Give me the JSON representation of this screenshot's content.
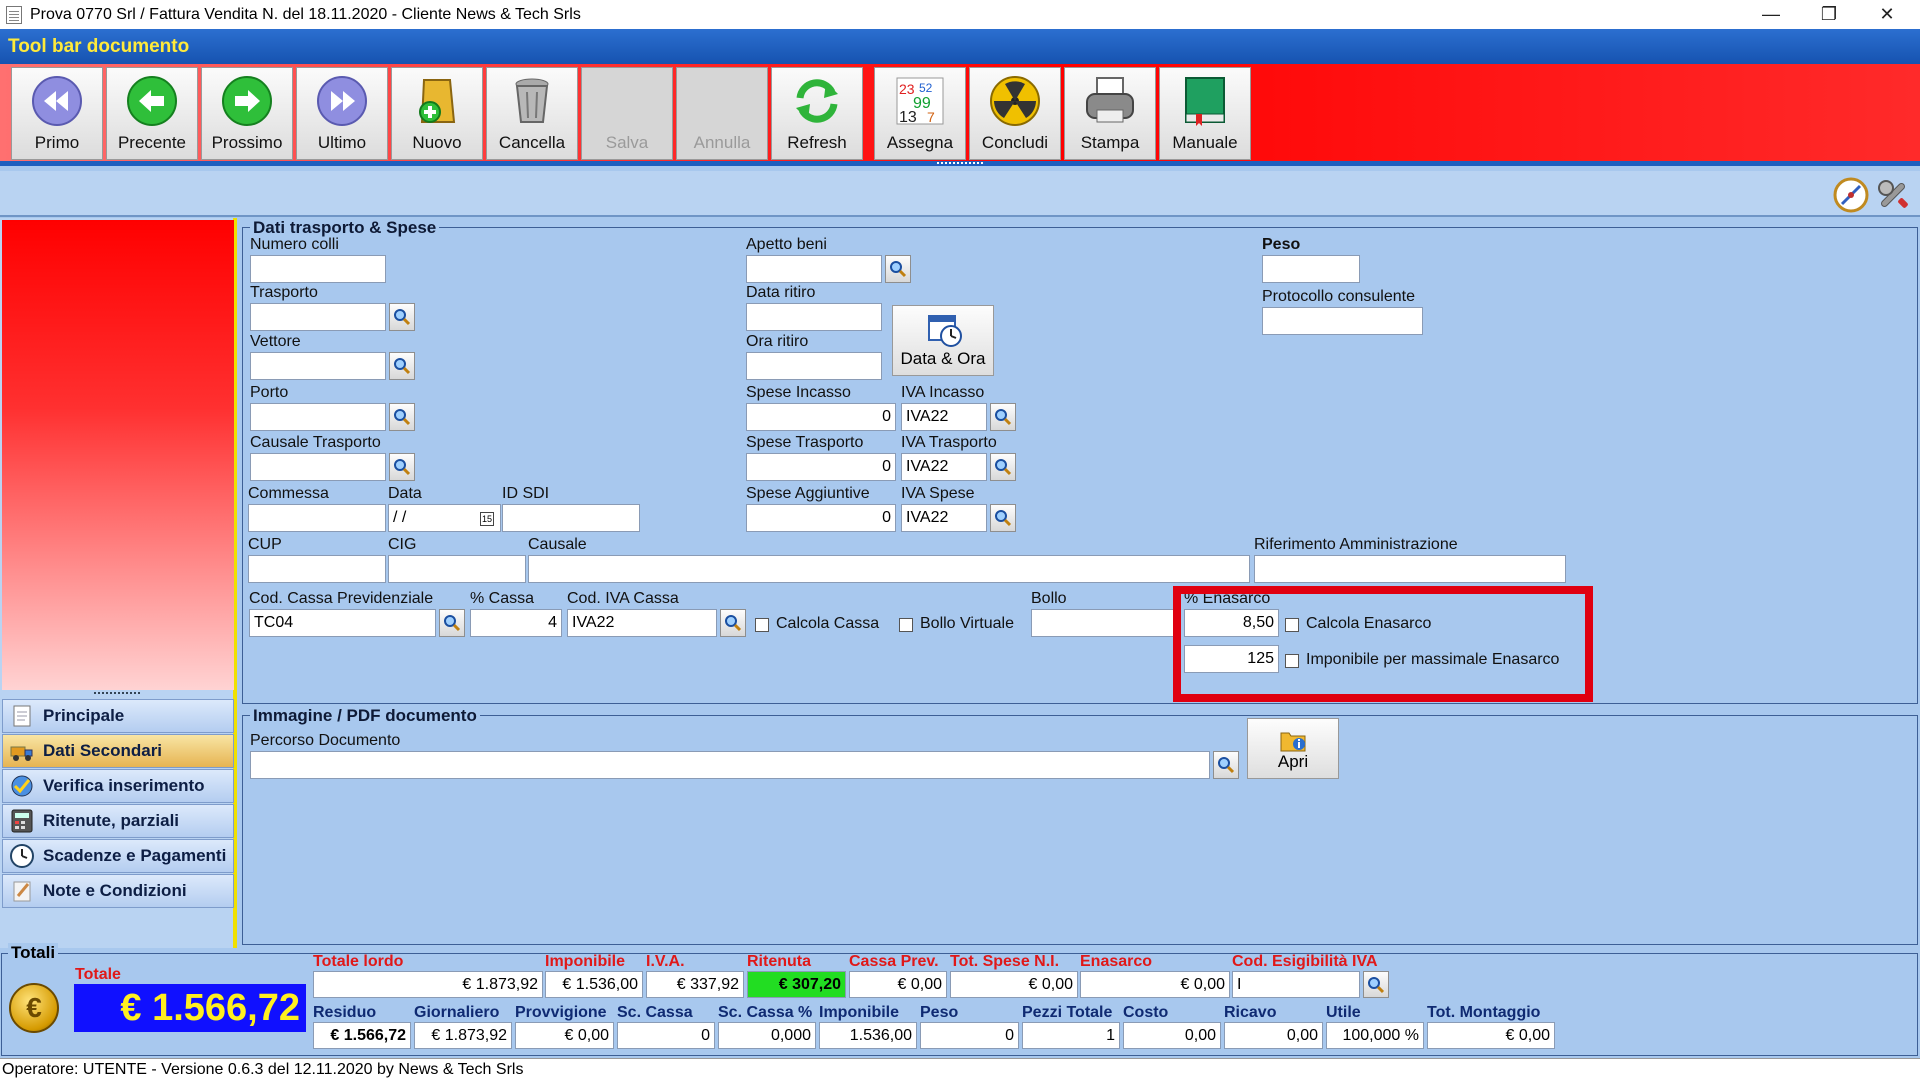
{
  "window": {
    "title": "Prova 0770 Srl / Fattura Vendita N.  del 18.11.2020 - Cliente News & Tech Srls",
    "minimize": "—",
    "maximize": "❐",
    "close": "✕"
  },
  "toolbar": {
    "header": "Tool bar documento",
    "buttons": {
      "primo": "Primo",
      "precente": "Precente",
      "prossimo": "Prossimo",
      "ultimo": "Ultimo",
      "nuovo": "Nuovo",
      "cancella": "Cancella",
      "salva": "Salva",
      "annulla": "Annulla",
      "refresh": "Refresh",
      "assegna": "Assegna",
      "concludi": "Concludi",
      "stampa": "Stampa",
      "manuale": "Manuale"
    }
  },
  "nav": {
    "items": [
      "Principale",
      "Dati Secondari",
      "Verifica inserimento",
      "Ritenute, parziali",
      "Scadenze e Pagamenti",
      "Note e Condizioni"
    ],
    "active": "Dati Secondari"
  },
  "trasporto": {
    "title": "Dati trasporto & Spese",
    "numero_colli": {
      "label": "Numero colli",
      "value": ""
    },
    "trasporto": {
      "label": "Trasporto",
      "value": ""
    },
    "vettore": {
      "label": "Vettore",
      "value": ""
    },
    "porto": {
      "label": "Porto",
      "value": ""
    },
    "causale_trasporto": {
      "label": "Causale Trasporto",
      "value": ""
    },
    "commessa": {
      "label": "Commessa",
      "value": ""
    },
    "data": {
      "label": "Data",
      "value": " /  /"
    },
    "id_sdi": {
      "label": "ID SDI",
      "value": ""
    },
    "cup": {
      "label": "CUP",
      "value": ""
    },
    "cig": {
      "label": "CIG",
      "value": ""
    },
    "causale": {
      "label": "Causale",
      "value": ""
    },
    "riferimento": {
      "label": "Riferimento Amministrazione",
      "value": ""
    },
    "apetto_beni": {
      "label": "Apetto beni",
      "value": ""
    },
    "data_ritiro": {
      "label": "Data ritiro",
      "value": ""
    },
    "ora_ritiro": {
      "label": "Ora ritiro",
      "value": ""
    },
    "data_ora_button": "Data & Ora",
    "spese_incasso": {
      "label": "Spese Incasso",
      "value": "0"
    },
    "iva_incasso": {
      "label": "IVA Incasso",
      "value": "IVA22"
    },
    "spese_trasporto": {
      "label": "Spese Trasporto",
      "value": "0"
    },
    "iva_trasporto": {
      "label": "IVA Trasporto",
      "value": "IVA22"
    },
    "spese_aggiuntive": {
      "label": "Spese Aggiuntive",
      "value": "0"
    },
    "iva_spese": {
      "label": "IVA Spese",
      "value": "IVA22"
    },
    "peso": {
      "label": "Peso",
      "value": ""
    },
    "protocollo": {
      "label": "Protocollo consulente",
      "value": ""
    },
    "cod_cassa": {
      "label": "Cod. Cassa Previdenziale",
      "value": "TC04"
    },
    "perc_cassa": {
      "label": "% Cassa",
      "value": "4"
    },
    "cod_iva_cassa": {
      "label": "Cod. IVA Cassa",
      "value": "IVA22"
    },
    "calcola_cassa": "Calcola Cassa",
    "bollo_virtuale": "Bollo Virtuale",
    "bollo": {
      "label": "Bollo",
      "value": ""
    },
    "perc_enasarco": {
      "label": "% Enasarco",
      "value": "8,50"
    },
    "calcola_enasarco": "Calcola Enasarco",
    "imponibile_massimale": {
      "value": "125",
      "label": "Imponibile per massimale Enasarco"
    }
  },
  "immagine": {
    "title": "Immagine / PDF documento",
    "percorso": {
      "label": "Percorso Documento",
      "value": ""
    },
    "apri": "Apri"
  },
  "totali": {
    "title": "Totali",
    "totale_label": "Totale",
    "totale_value": "€ 1.566,72",
    "coin": "€",
    "row1": [
      {
        "label": "Totale lordo",
        "value": "€ 1.873,92"
      },
      {
        "label": "Imponibile",
        "value": "€ 1.536,00"
      },
      {
        "label": "I.V.A.",
        "value": "€ 337,92"
      },
      {
        "label": "Ritenuta",
        "value": "€ 307,20"
      },
      {
        "label": "Cassa Prev.",
        "value": "€ 0,00"
      },
      {
        "label": "Tot. Spese N.I.",
        "value": "€ 0,00"
      },
      {
        "label": "Enasarco",
        "value": "€ 0,00"
      },
      {
        "label": "Cod. Esigibilità IVA",
        "value": "I"
      }
    ],
    "row2": [
      {
        "label": "Residuo",
        "value": "€ 1.566,72"
      },
      {
        "label": "Giornaliero",
        "value": "€ 1.873,92"
      },
      {
        "label": "Provvigione",
        "value": "€ 0,00"
      },
      {
        "label": "Sc. Cassa",
        "value": "0"
      },
      {
        "label": "Sc. Cassa %",
        "value": "0,000"
      },
      {
        "label": "Imponibile",
        "value": "1.536,00"
      },
      {
        "label": "Peso",
        "value": "0"
      },
      {
        "label": "Pezzi Totale",
        "value": "1"
      },
      {
        "label": "Costo",
        "value": "0,00"
      },
      {
        "label": "Ricavo",
        "value": "0,00"
      },
      {
        "label": "Utile",
        "value": "100,000 %"
      },
      {
        "label": "Tot. Montaggio",
        "value": "€ 0,00"
      }
    ]
  },
  "status": "Operatore: UTENTE - Versione 0.6.3 del 12.11.2020 by News & Tech Srls",
  "colors": {
    "accent_red": "#ff0000",
    "header_blue": "#1653b0",
    "header_text": "#ffea3a",
    "highlight_box": "#e00010"
  }
}
